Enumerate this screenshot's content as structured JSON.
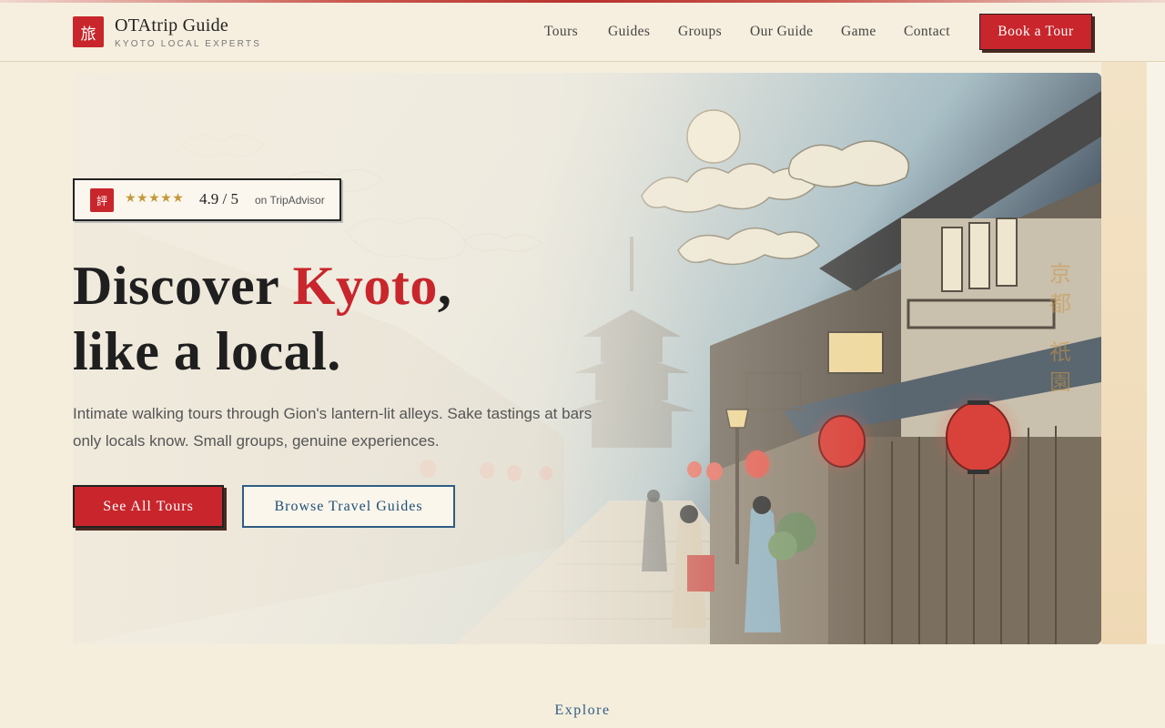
{
  "header": {
    "logo_glyph": "旅",
    "brand_name": "OTAtrip Guide",
    "brand_sub": "KYOTO LOCAL EXPERTS",
    "nav": [
      "Tours",
      "Guides",
      "Groups",
      "Our Guide",
      "Game",
      "Contact"
    ],
    "cta": "Book a Tour"
  },
  "hero": {
    "rating": {
      "icon_glyph": "評",
      "stars": "★★★★★",
      "score": "4.9 / 5",
      "source": "on TripAdvisor"
    },
    "headline_part1": "Discover ",
    "headline_accent": "Kyoto",
    "headline_part2": ",",
    "headline_line2": "like a local.",
    "subcopy": "Intimate walking tours through Gion's lantern-lit alleys. Sake tastings at bars only locals know. Small groups, genuine experiences.",
    "primary_button": "See All Tours",
    "secondary_button": "Browse Travel Guides",
    "vertical_kanji": [
      "京",
      "都",
      "",
      "祇",
      "園"
    ]
  },
  "explore_label": "Explore",
  "colors": {
    "accent_red": "#c8262c",
    "accent_blue": "#2f5d82",
    "background": "#f5eedd"
  }
}
